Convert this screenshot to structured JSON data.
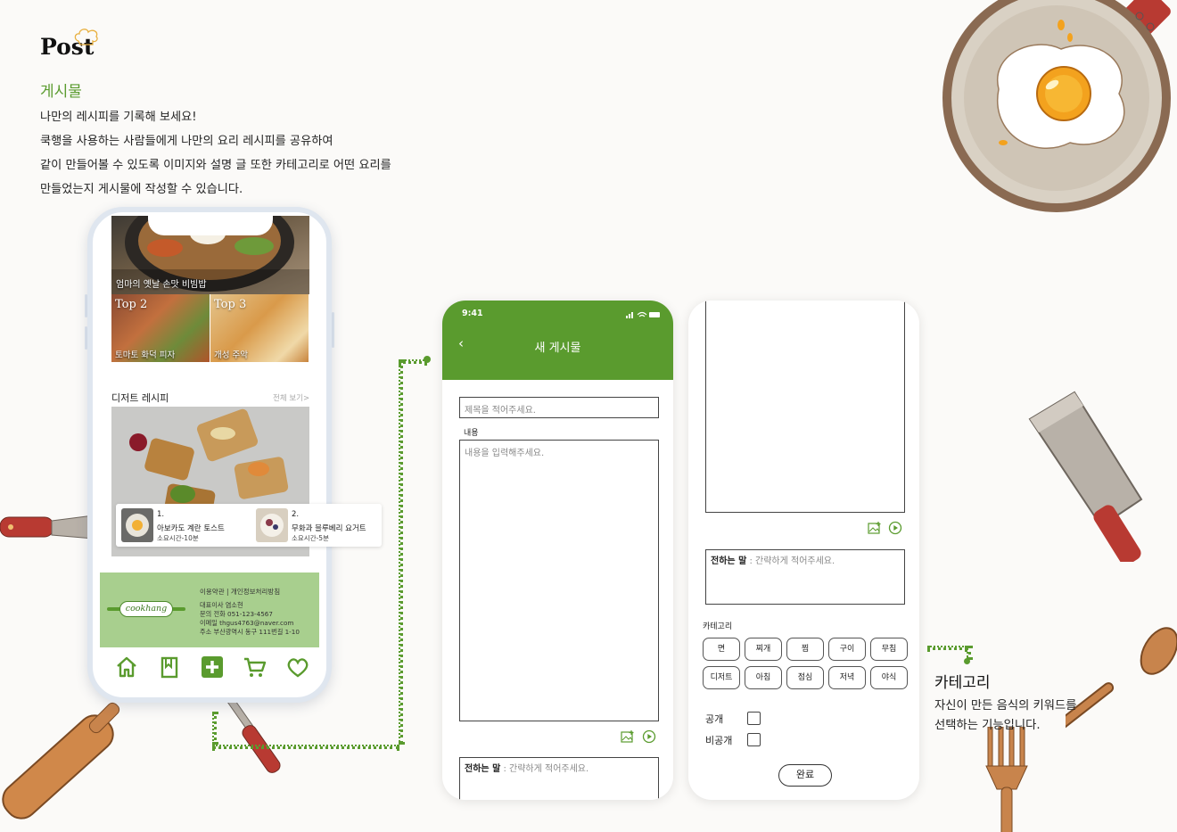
{
  "header": {
    "logo_text": "Post",
    "section_title": "게시물",
    "description": [
      "나만의 레시피를 기록해 보세요!",
      "쿡행을 사용하는 사람들에게 나만의 요리 레시피를 공유하여",
      "같이 만들어볼 수 있도록 이미지와 설명 글 또한 카테고리로 어떤 요리를",
      "만들었는지 게시물에 작성할 수 있습니다."
    ]
  },
  "home_screen": {
    "hero_caption": "엄마의 옛날 손맛 비빔밥",
    "tiles": [
      {
        "rank": "Top 2",
        "caption": "토마토 화덕 피자"
      },
      {
        "rank": "Top 3",
        "caption": "개성 주악"
      }
    ],
    "dessert_section": {
      "title": "디저트 레시피",
      "see_all": "전체 보기>"
    },
    "cards": [
      {
        "num": "1.",
        "title": "아보카도 계란 토스트",
        "time": "소요시간-10분"
      },
      {
        "num": "2.",
        "title": "무화과 블루베리 요거트",
        "time": "소요시간-5분"
      }
    ],
    "footer": {
      "brand": "cookhang",
      "links": "이용약관  |  개인정보처리방침",
      "info": [
        "대표이사    염소현",
        "문의 전화    051-123-4567",
        "이메일    thgus4763@naver.com",
        "주소    부산광역시 동구 111번길 1-10"
      ]
    },
    "tab_icons": [
      "home-icon",
      "bookmark-icon",
      "add-icon",
      "cart-icon",
      "heart-icon"
    ]
  },
  "new_post_screen": {
    "time": "9:41",
    "back_glyph": "‹",
    "title": "새 게시물",
    "title_placeholder": "제목을 적어주세요.",
    "content_label": "내용",
    "content_placeholder": "내용을 입력해주세요.",
    "message_label": "전하는 말",
    "message_placeholder": " : 간략하게 적어주세요."
  },
  "category_screen": {
    "message_label": "전하는 말",
    "message_placeholder": " : 간략하게 적어주세요.",
    "category_label": "카테고리",
    "categories_row1": [
      "면",
      "찌개",
      "찜",
      "구이",
      "무침"
    ],
    "categories_row2": [
      "디저트",
      "아침",
      "점심",
      "저녁",
      "야식"
    ],
    "public_label": "공개",
    "private_label": "비공개",
    "done_label": "완료"
  },
  "callout": {
    "title": "카테고리",
    "description": [
      "자신이 만든 음식의 키워드를",
      "선택하는 기능입니다."
    ]
  },
  "colors": {
    "accent_green": "#5a9b2e",
    "footer_green": "#a8cf8e",
    "phone_frame": "#dfe6ef"
  }
}
